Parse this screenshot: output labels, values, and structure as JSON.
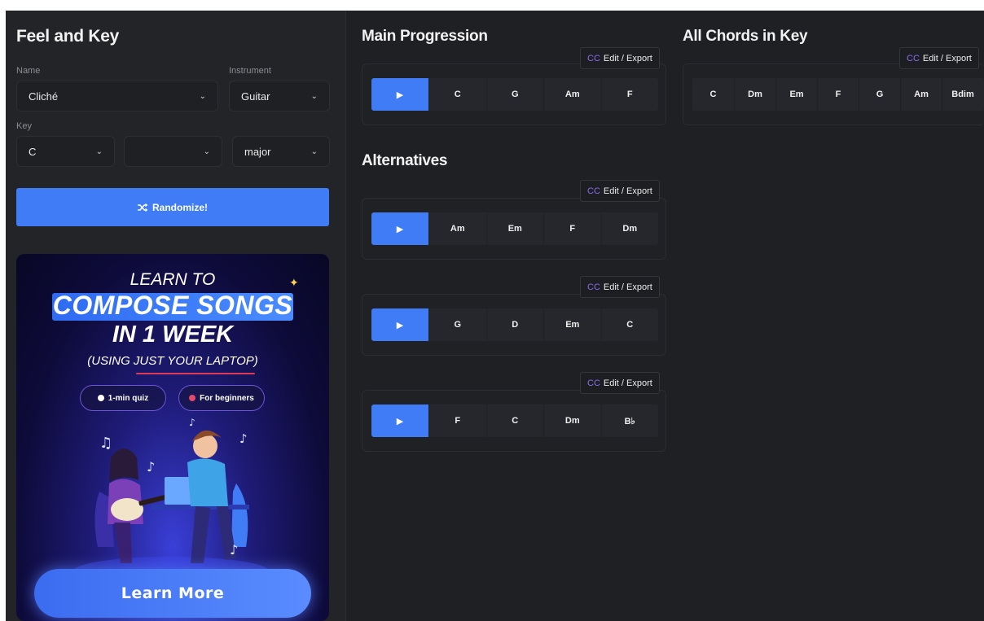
{
  "left": {
    "title": "Feel and Key",
    "name_label": "Name",
    "name_value": "Cliché",
    "instrument_label": "Instrument",
    "instrument_value": "Guitar",
    "key_label": "Key",
    "key_root": "C",
    "key_accidental": "",
    "key_mode": "major",
    "randomize_label": "Randomize!",
    "randomize_icon": "shuffle-icon"
  },
  "ad": {
    "line1": "LEARN TO",
    "line2": "COMPOSE SONGS",
    "line3": "IN 1 WEEK",
    "line4": "(USING JUST YOUR LAPTOP)",
    "pill1": "1-min quiz",
    "pill2": "For beginners",
    "cta": "Learn More"
  },
  "main": {
    "title": "Main Progression",
    "export_cc": "CC",
    "export_label": "Edit / Export",
    "play_icon": "play-icon",
    "chords": [
      "C",
      "G",
      "Am",
      "F"
    ]
  },
  "alternatives": {
    "title": "Alternatives",
    "export_cc": "CC",
    "export_label": "Edit / Export",
    "progressions": [
      {
        "chords": [
          "Am",
          "Em",
          "F",
          "Dm"
        ]
      },
      {
        "chords": [
          "G",
          "D",
          "Em",
          "C"
        ]
      },
      {
        "chords": [
          "F",
          "C",
          "Dm",
          "B♭"
        ]
      }
    ]
  },
  "all_chords": {
    "title": "All Chords in Key",
    "export_cc": "CC",
    "export_label": "Edit / Export",
    "chords": [
      "C",
      "Dm",
      "Em",
      "F",
      "G",
      "Am",
      "Bdim"
    ]
  },
  "colors": {
    "accent": "#3f7cf5",
    "background": "#1f2024",
    "panel": "#232428",
    "cc": "#8b6cf0"
  }
}
